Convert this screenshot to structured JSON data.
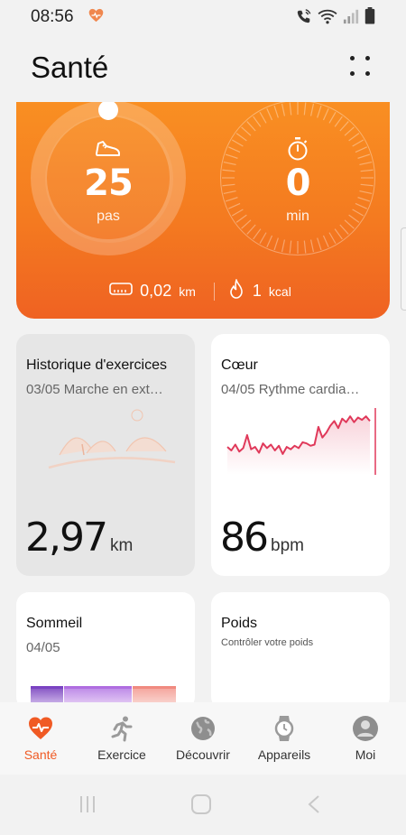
{
  "status": {
    "time": "08:56"
  },
  "header": {
    "title": "Santé"
  },
  "activity": {
    "steps_value": "25",
    "steps_unit": "pas",
    "minutes_value": "0",
    "minutes_unit": "min",
    "distance_value": "0,02",
    "distance_unit": "km",
    "calories_value": "1",
    "calories_unit": "kcal"
  },
  "cards": {
    "exercise": {
      "title": "Historique d'exercices",
      "subtitle": "03/05 Marche en ext…",
      "value": "2,97",
      "unit": "km"
    },
    "heart": {
      "title": "Cœur",
      "subtitle": "04/05 Rythme cardia…",
      "value": "86",
      "unit": "bpm"
    },
    "sleep": {
      "title": "Sommeil",
      "subtitle": "04/05"
    },
    "weight": {
      "title": "Poids",
      "subtitle": "Contrôler votre poids"
    }
  },
  "heart_trend": [
    58,
    55,
    60,
    54,
    57,
    68,
    56,
    58,
    53,
    61,
    57,
    60,
    55,
    59,
    52,
    58,
    56,
    59,
    57,
    62,
    61,
    59,
    60,
    75,
    66,
    70,
    76,
    80,
    74,
    82,
    79,
    84,
    79,
    83,
    81,
    84,
    80
  ],
  "nav": [
    {
      "label": "Santé",
      "icon": "heart-pulse-icon",
      "active": true
    },
    {
      "label": "Exercice",
      "icon": "runner-icon",
      "active": false
    },
    {
      "label": "Découvrir",
      "icon": "globe-icon",
      "active": false
    },
    {
      "label": "Appareils",
      "icon": "watch-icon",
      "active": false
    },
    {
      "label": "Moi",
      "icon": "profile-icon",
      "active": false
    }
  ],
  "colors": {
    "accent": "#f05a24",
    "heart_line": "#e0395a",
    "orange_top": "#f98f22",
    "orange_bottom": "#ef6222"
  }
}
